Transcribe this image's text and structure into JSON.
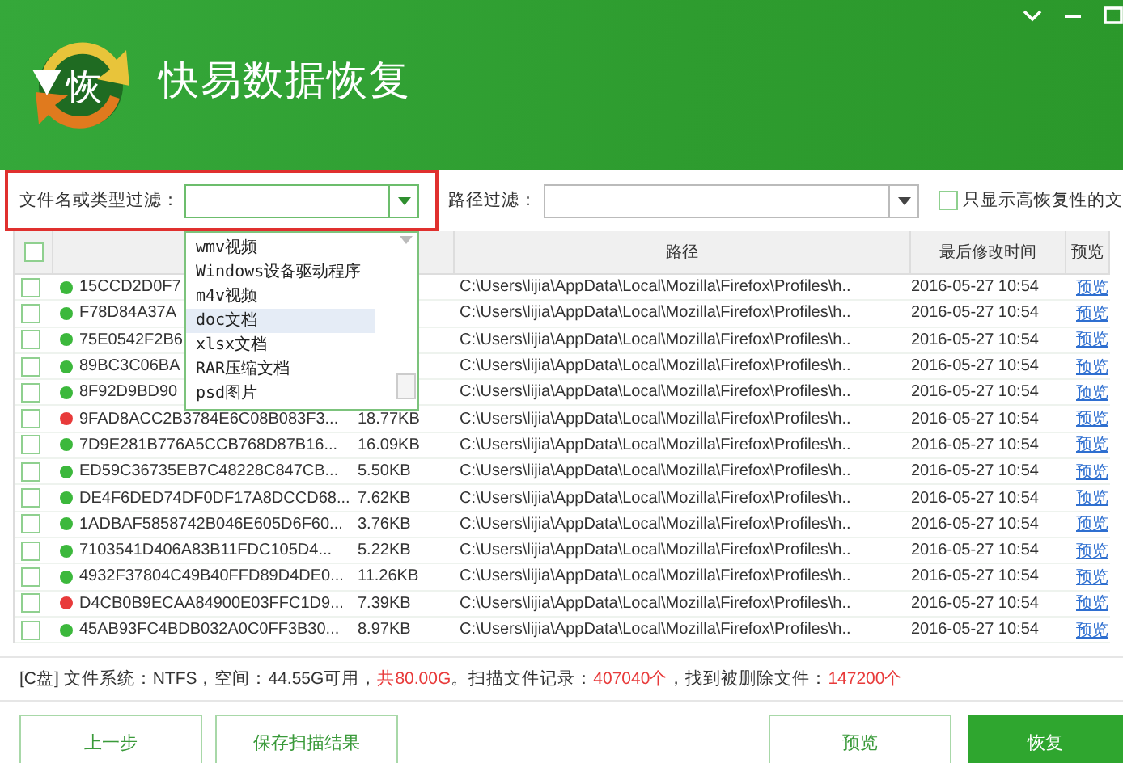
{
  "window": {
    "logo_text": "恢",
    "title": "快易数据恢复"
  },
  "filters": {
    "type_label": "文件名或类型过滤：",
    "path_label": "路径过滤：",
    "high_only": {
      "label": "只显示高恢复性的文",
      "checked": false
    }
  },
  "type_dropdown": {
    "items": [
      {
        "label": "wmv视频",
        "selected": false
      },
      {
        "label": "Windows设备驱动程序",
        "selected": false
      },
      {
        "label": "m4v视频",
        "selected": false
      },
      {
        "label": "doc文档",
        "selected": true
      },
      {
        "label": "xlsx文档",
        "selected": false
      },
      {
        "label": "RAR压缩文档",
        "selected": false
      },
      {
        "label": "psd图片",
        "selected": false
      }
    ]
  },
  "table": {
    "header_checked": false,
    "columns": [
      "路径",
      "最后修改时间",
      "预览"
    ],
    "rows": [
      {
        "checked": false,
        "color": "#3cb83c",
        "name": "15CCD2D0F7",
        "path": "C:\\Users\\lijia\\AppData\\Local\\Mozilla\\Firefox\\Profiles\\h..",
        "time": "2016-05-27  10:54",
        "preview": "预览"
      },
      {
        "checked": false,
        "color": "#3cb83c",
        "name": "F78D84A37A",
        "path": "C:\\Users\\lijia\\AppData\\Local\\Mozilla\\Firefox\\Profiles\\h..",
        "time": "2016-05-27  10:54",
        "preview": "预览"
      },
      {
        "checked": false,
        "color": "#3cb83c",
        "name": "75E0542F2B6",
        "path": "C:\\Users\\lijia\\AppData\\Local\\Mozilla\\Firefox\\Profiles\\h..",
        "time": "2016-05-27  10:54",
        "preview": "预览"
      },
      {
        "checked": false,
        "color": "#3cb83c",
        "name": "89BC3C06BA",
        "path": "C:\\Users\\lijia\\AppData\\Local\\Mozilla\\Firefox\\Profiles\\h..",
        "time": "2016-05-27  10:54",
        "preview": "预览"
      },
      {
        "checked": false,
        "color": "#3cb83c",
        "name": "8F92D9BD90",
        "path": "C:\\Users\\lijia\\AppData\\Local\\Mozilla\\Firefox\\Profiles\\h..",
        "time": "2016-05-27  10:54",
        "preview": "预览"
      },
      {
        "checked": false,
        "color": "#e83a3a",
        "name": "9FAD8ACC2B3784E6C08B083F3...",
        "size": "18.77KB",
        "path": "C:\\Users\\lijia\\AppData\\Local\\Mozilla\\Firefox\\Profiles\\h..",
        "time": "2016-05-27  10:54",
        "preview": "预览"
      },
      {
        "checked": false,
        "color": "#3cb83c",
        "name": "7D9E281B776A5CCB768D87B16...",
        "size": "16.09KB",
        "path": "C:\\Users\\lijia\\AppData\\Local\\Mozilla\\Firefox\\Profiles\\h..",
        "time": "2016-05-27  10:54",
        "preview": "预览"
      },
      {
        "checked": false,
        "color": "#3cb83c",
        "name": "ED59C36735EB7C48228C847CB...",
        "size": "5.50KB",
        "path": "C:\\Users\\lijia\\AppData\\Local\\Mozilla\\Firefox\\Profiles\\h..",
        "time": "2016-05-27  10:54",
        "preview": "预览"
      },
      {
        "checked": false,
        "color": "#3cb83c",
        "name": "DE4F6DED74DF0DF17A8DCCD68...",
        "size": "7.62KB",
        "path": "C:\\Users\\lijia\\AppData\\Local\\Mozilla\\Firefox\\Profiles\\h..",
        "time": "2016-05-27  10:54",
        "preview": "预览"
      },
      {
        "checked": false,
        "color": "#3cb83c",
        "name": "1ADBAF5858742B046E605D6F60...",
        "size": "3.76KB",
        "path": "C:\\Users\\lijia\\AppData\\Local\\Mozilla\\Firefox\\Profiles\\h..",
        "time": "2016-05-27  10:54",
        "preview": "预览"
      },
      {
        "checked": false,
        "color": "#3cb83c",
        "name": "7103541D406A83B11FDC105D4...",
        "size": "5.22KB",
        "path": "C:\\Users\\lijia\\AppData\\Local\\Mozilla\\Firefox\\Profiles\\h..",
        "time": "2016-05-27  10:54",
        "preview": "预览"
      },
      {
        "checked": false,
        "color": "#3cb83c",
        "name": "4932F37804C49B40FFD89D4DE0...",
        "size": "11.26KB",
        "path": "C:\\Users\\lijia\\AppData\\Local\\Mozilla\\Firefox\\Profiles\\h..",
        "time": "2016-05-27  10:54",
        "preview": "预览"
      },
      {
        "checked": false,
        "color": "#e83a3a",
        "name": "D4CB0B9ECAA84900E03FFC1D9...",
        "size": "7.39KB",
        "path": "C:\\Users\\lijia\\AppData\\Local\\Mozilla\\Firefox\\Profiles\\h..",
        "time": "2016-05-27  10:54",
        "preview": "预览"
      },
      {
        "checked": false,
        "color": "#3cb83c",
        "name": "45AB93FC4BDB032A0C0FF3B30...",
        "size": "8.97KB",
        "path": "C:\\Users\\lijia\\AppData\\Local\\Mozilla\\Firefox\\Profiles\\h..",
        "time": "2016-05-27  10:54",
        "preview": "预览"
      }
    ]
  },
  "status": [
    {
      "kind": "plain",
      "text": "[C盘] 文件系统：NTFS，空间：44.55G可用，"
    },
    {
      "kind": "count",
      "text": "共80.00G"
    },
    {
      "kind": "plain",
      "text": "。扫描文件记录："
    },
    {
      "kind": "count",
      "text": "407040个"
    },
    {
      "kind": "plain",
      "text": "，找到被删除文件："
    },
    {
      "kind": "count",
      "text": "147200个"
    }
  ],
  "buttons": [
    {
      "label": "上一步",
      "kind": "plain"
    },
    {
      "label": "保存扫描结果",
      "kind": "plain"
    },
    {
      "label": "预览",
      "kind": "plain"
    },
    {
      "label": "恢复",
      "kind": "primary"
    }
  ]
}
